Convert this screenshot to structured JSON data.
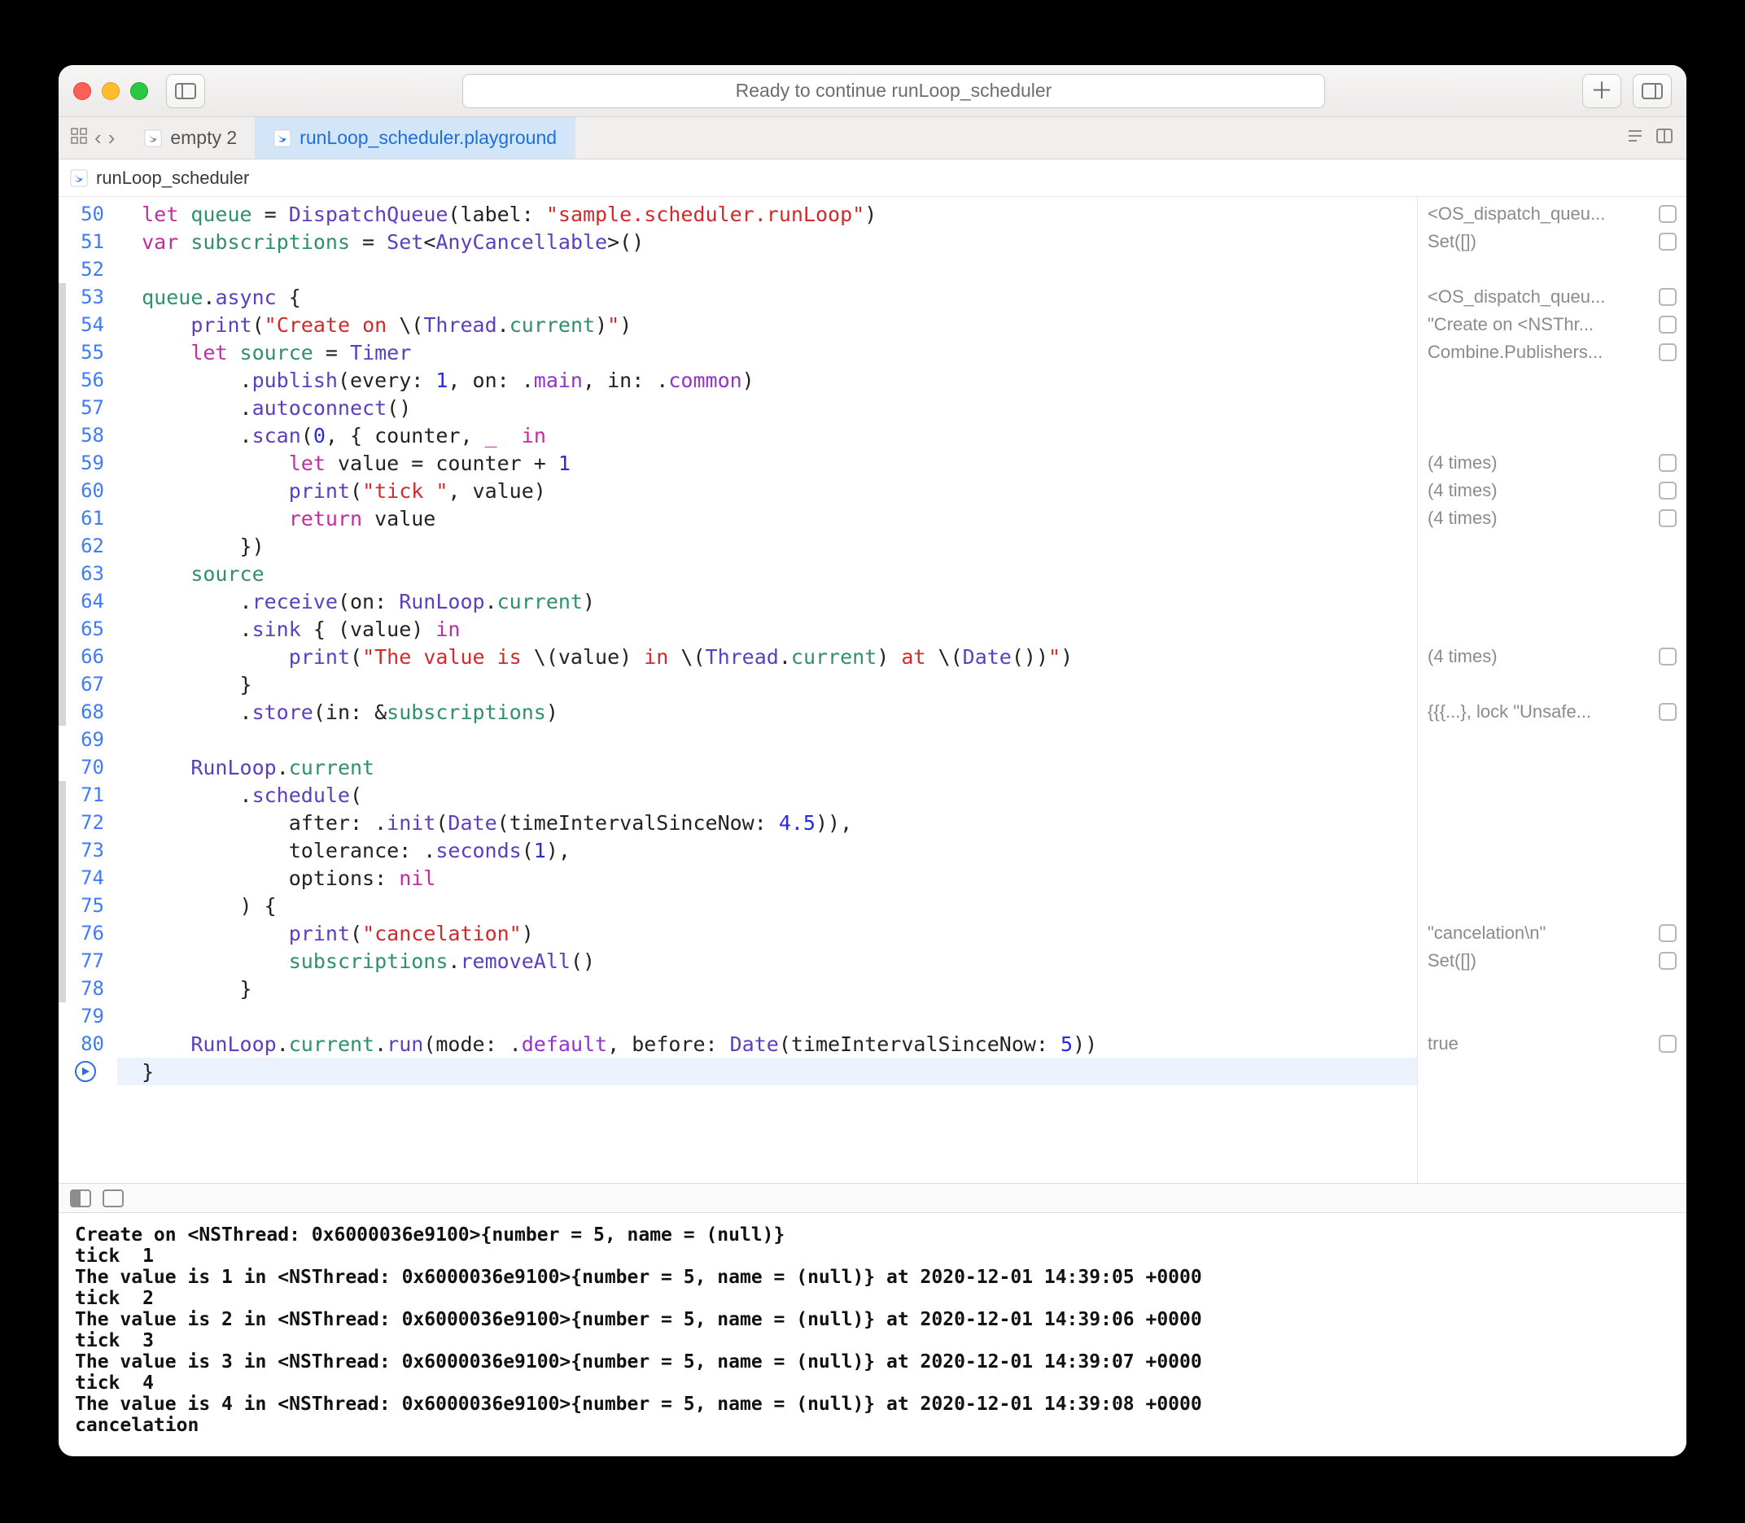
{
  "title": "Ready to continue runLoop_scheduler",
  "tabs": [
    {
      "label": "empty 2",
      "active": false
    },
    {
      "label": "runLoop_scheduler.playground",
      "active": true
    }
  ],
  "breadcrumb": "runLoop_scheduler",
  "lineStart": 50,
  "lineEnd": 81,
  "execMarkedLines": [
    53,
    54,
    55,
    56,
    57,
    58,
    59,
    60,
    61,
    62,
    63,
    64,
    65,
    66,
    67,
    68,
    71,
    72,
    73,
    74,
    75,
    76,
    77,
    78
  ],
  "code": {
    "50": [
      [
        "kw",
        "let"
      ],
      [
        "",
        " "
      ],
      [
        "id",
        "queue"
      ],
      [
        "",
        " = "
      ],
      [
        "type",
        "DispatchQueue"
      ],
      [
        "",
        "(label: "
      ],
      [
        "str",
        "\"sample.scheduler.runLoop\""
      ],
      [
        "",
        ")"
      ]
    ],
    "51": [
      [
        "kw",
        "var"
      ],
      [
        "",
        " "
      ],
      [
        "id",
        "subscriptions"
      ],
      [
        "",
        " = "
      ],
      [
        "type",
        "Set"
      ],
      [
        "",
        "<"
      ],
      [
        "type",
        "AnyCancellable"
      ],
      [
        "",
        ">()"
      ]
    ],
    "52": [
      [
        "",
        ""
      ]
    ],
    "53": [
      [
        "id",
        "queue"
      ],
      [
        "",
        "."
      ],
      [
        "fn",
        "async"
      ],
      [
        "",
        " {"
      ]
    ],
    "54": [
      [
        "",
        "    "
      ],
      [
        "fn",
        "print"
      ],
      [
        "",
        "("
      ],
      [
        "str",
        "\"Create on "
      ],
      [
        "",
        "\\("
      ],
      [
        "type",
        "Thread"
      ],
      [
        "",
        "."
      ],
      [
        "prop",
        "current"
      ],
      [
        "",
        ")"
      ],
      [
        "str",
        "\""
      ],
      [
        "",
        ")"
      ]
    ],
    "55": [
      [
        "",
        "    "
      ],
      [
        "kw",
        "let"
      ],
      [
        "",
        " "
      ],
      [
        "id",
        "source"
      ],
      [
        "",
        " = "
      ],
      [
        "type",
        "Timer"
      ]
    ],
    "56": [
      [
        "",
        "        ."
      ],
      [
        "fn",
        "publish"
      ],
      [
        "",
        "(every: "
      ],
      [
        "num",
        "1"
      ],
      [
        "",
        ", on: ."
      ],
      [
        "enum",
        "main"
      ],
      [
        "",
        ", in: ."
      ],
      [
        "enum",
        "common"
      ],
      [
        "",
        ")"
      ]
    ],
    "57": [
      [
        "",
        "        ."
      ],
      [
        "fn",
        "autoconnect"
      ],
      [
        "",
        "()"
      ]
    ],
    "58": [
      [
        "",
        "        ."
      ],
      [
        "fn",
        "scan"
      ],
      [
        "",
        "("
      ],
      [
        "num",
        "0"
      ],
      [
        "",
        ", { counter, "
      ],
      [
        "kw",
        "_"
      ],
      [
        "",
        "  "
      ],
      [
        "kw",
        "in"
      ]
    ],
    "59": [
      [
        "",
        "            "
      ],
      [
        "kw",
        "let"
      ],
      [
        "",
        " value = counter + "
      ],
      [
        "num",
        "1"
      ]
    ],
    "60": [
      [
        "",
        "            "
      ],
      [
        "fn",
        "print"
      ],
      [
        "",
        "("
      ],
      [
        "str",
        "\"tick \""
      ],
      [
        "",
        ", value)"
      ]
    ],
    "61": [
      [
        "",
        "            "
      ],
      [
        "kw",
        "return"
      ],
      [
        "",
        " value"
      ]
    ],
    "62": [
      [
        "",
        "        })"
      ]
    ],
    "63": [
      [
        "",
        "    "
      ],
      [
        "id",
        "source"
      ]
    ],
    "64": [
      [
        "",
        "        ."
      ],
      [
        "fn",
        "receive"
      ],
      [
        "",
        "(on: "
      ],
      [
        "type",
        "RunLoop"
      ],
      [
        "",
        "."
      ],
      [
        "prop",
        "current"
      ],
      [
        "",
        ")"
      ]
    ],
    "65": [
      [
        "",
        "        ."
      ],
      [
        "fn",
        "sink"
      ],
      [
        "",
        " { (value) "
      ],
      [
        "kw",
        "in"
      ]
    ],
    "66": [
      [
        "",
        "            "
      ],
      [
        "fn",
        "print"
      ],
      [
        "",
        "("
      ],
      [
        "str",
        "\"The value is "
      ],
      [
        "",
        "\\(value)"
      ],
      [
        "str",
        " in "
      ],
      [
        "",
        "\\("
      ],
      [
        "type",
        "Thread"
      ],
      [
        "",
        "."
      ],
      [
        "prop",
        "current"
      ],
      [
        "",
        ")"
      ],
      [
        "str",
        " at "
      ],
      [
        "",
        "\\("
      ],
      [
        "type",
        "Date"
      ],
      [
        "",
        "())"
      ],
      [
        "str",
        "\""
      ],
      [
        "",
        ")"
      ]
    ],
    "67": [
      [
        "",
        "        }"
      ]
    ],
    "68": [
      [
        "",
        "        ."
      ],
      [
        "fn",
        "store"
      ],
      [
        "",
        "(in: &"
      ],
      [
        "id",
        "subscriptions"
      ],
      [
        "",
        ")"
      ]
    ],
    "69": [
      [
        "",
        ""
      ]
    ],
    "70": [
      [
        "",
        "    "
      ],
      [
        "type",
        "RunLoop"
      ],
      [
        "",
        "."
      ],
      [
        "prop",
        "current"
      ]
    ],
    "71": [
      [
        "",
        "        ."
      ],
      [
        "fn",
        "schedule"
      ],
      [
        "",
        "("
      ]
    ],
    "72": [
      [
        "",
        "            after: ."
      ],
      [
        "fn",
        "init"
      ],
      [
        "",
        "("
      ],
      [
        "type",
        "Date"
      ],
      [
        "",
        "(timeIntervalSinceNow: "
      ],
      [
        "num",
        "4.5"
      ],
      [
        "",
        ")),"
      ]
    ],
    "73": [
      [
        "",
        "            tolerance: ."
      ],
      [
        "fn",
        "seconds"
      ],
      [
        "",
        "("
      ],
      [
        "num",
        "1"
      ],
      [
        "",
        "),"
      ]
    ],
    "74": [
      [
        "",
        "            options: "
      ],
      [
        "kw",
        "nil"
      ]
    ],
    "75": [
      [
        "",
        "        ) {"
      ]
    ],
    "76": [
      [
        "",
        "            "
      ],
      [
        "fn",
        "print"
      ],
      [
        "",
        "("
      ],
      [
        "str",
        "\"cancelation\""
      ],
      [
        "",
        ")"
      ]
    ],
    "77": [
      [
        "",
        "            "
      ],
      [
        "id",
        "subscriptions"
      ],
      [
        "",
        "."
      ],
      [
        "fn",
        "removeAll"
      ],
      [
        "",
        "()"
      ]
    ],
    "78": [
      [
        "",
        "        }"
      ]
    ],
    "79": [
      [
        "",
        ""
      ]
    ],
    "80": [
      [
        "",
        "    "
      ],
      [
        "type",
        "RunLoop"
      ],
      [
        "",
        "."
      ],
      [
        "prop",
        "current"
      ],
      [
        "",
        "."
      ],
      [
        "fn",
        "run"
      ],
      [
        "",
        "(mode: ."
      ],
      [
        "enum",
        "default"
      ],
      [
        "",
        ", before: "
      ],
      [
        "type",
        "Date"
      ],
      [
        "",
        "(timeIntervalSinceNow: "
      ],
      [
        "num",
        "5"
      ],
      [
        "",
        "))"
      ]
    ],
    "81": [
      [
        "",
        "}"
      ]
    ]
  },
  "sidebar": {
    "50": "<OS_dispatch_queu...",
    "51": "Set([])",
    "53": "<OS_dispatch_queu...",
    "54": "\"Create on <NSThr...",
    "55": "Combine.Publishers...",
    "59": "(4 times)",
    "60": "(4 times)",
    "61": "(4 times)",
    "66": "(4 times)",
    "68": "{{{...}, lock \"Unsafe...",
    "76": "\"cancelation\\n\"",
    "77": "Set([])",
    "80": "true"
  },
  "console": "Create on <NSThread: 0x6000036e9100>{number = 5, name = (null)}\ntick  1\nThe value is 1 in <NSThread: 0x6000036e9100>{number = 5, name = (null)} at 2020-12-01 14:39:05 +0000\ntick  2\nThe value is 2 in <NSThread: 0x6000036e9100>{number = 5, name = (null)} at 2020-12-01 14:39:06 +0000\ntick  3\nThe value is 3 in <NSThread: 0x6000036e9100>{number = 5, name = (null)} at 2020-12-01 14:39:07 +0000\ntick  4\nThe value is 4 in <NSThread: 0x6000036e9100>{number = 5, name = (null)} at 2020-12-01 14:39:08 +0000\ncancelation"
}
